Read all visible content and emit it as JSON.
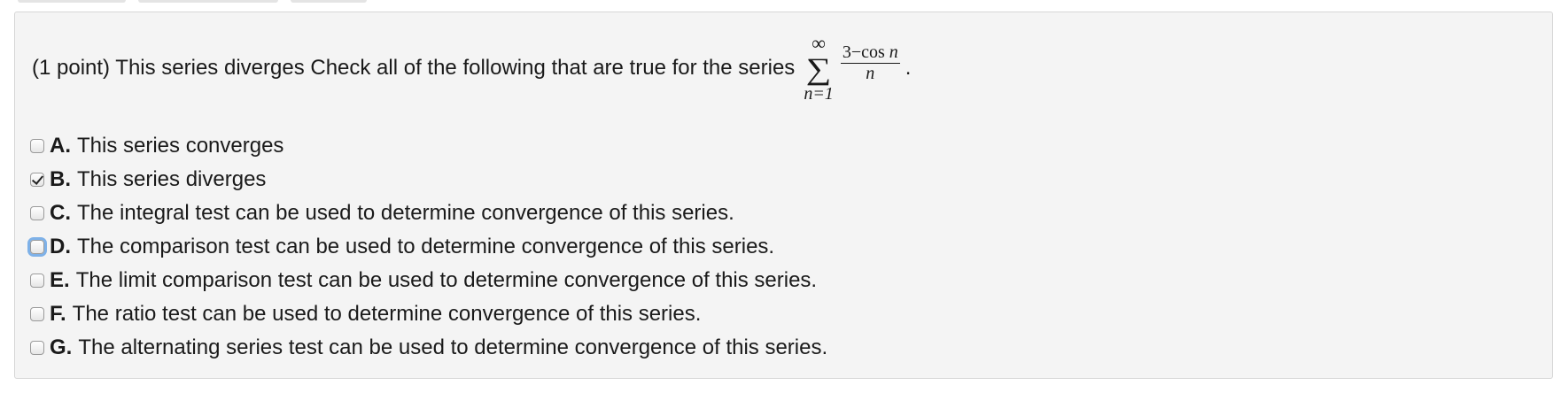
{
  "question": {
    "prefix": "(1 point) This series diverges Check all of the following that are true for the series",
    "sum_upper": "∞",
    "sum_symbol": "∑",
    "sum_lower": "n=1",
    "frac_numerator": "3−cos ",
    "frac_numerator_var": "n",
    "frac_denominator": "n",
    "suffix": "."
  },
  "options": [
    {
      "letter": "A.",
      "text": "This series converges",
      "checked": false,
      "focused": false
    },
    {
      "letter": "B.",
      "text": "This series diverges",
      "checked": true,
      "focused": false
    },
    {
      "letter": "C.",
      "text": "The integral test can be used to determine convergence of this series.",
      "checked": false,
      "focused": false
    },
    {
      "letter": "D.",
      "text": "The comparison test can be used to determine convergence of this series.",
      "checked": false,
      "focused": true
    },
    {
      "letter": "E.",
      "text": "The limit comparison test can be used to determine convergence of this series.",
      "checked": false,
      "focused": false
    },
    {
      "letter": "F.",
      "text": "The ratio test can be used to determine convergence of this series.",
      "checked": false,
      "focused": false
    },
    {
      "letter": "G.",
      "text": "The alternating series test can be used to determine convergence of this series.",
      "checked": false,
      "focused": false
    }
  ]
}
